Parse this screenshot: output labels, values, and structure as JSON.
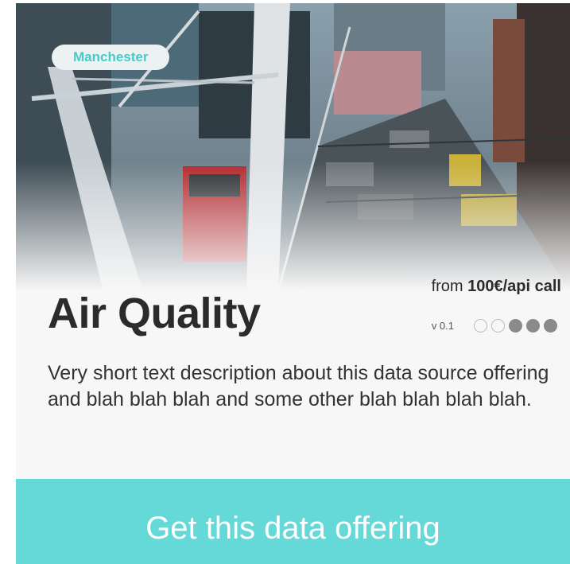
{
  "card": {
    "location": "Manchester",
    "title": "Air Quality",
    "price_prefix": "from ",
    "price": "100€/api call",
    "version": "v 0.1",
    "rating": {
      "filled": 3,
      "total": 5
    },
    "description": "Very short text description about this data source offering and blah blah blah and some other blah blah blah blah.",
    "cta_label": "Get this data offering"
  },
  "colors": {
    "accent": "#65d8d8",
    "badge_text": "#4ac9c9",
    "title": "#2b2b2b"
  }
}
